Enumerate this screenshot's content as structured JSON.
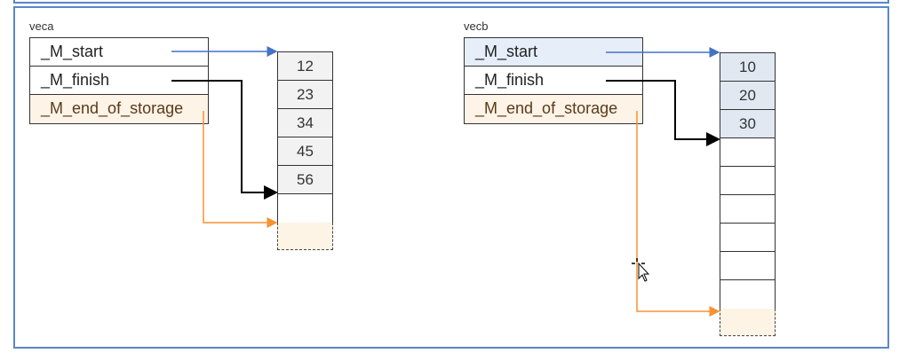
{
  "diagram": {
    "vectors": [
      {
        "name": "veca",
        "fields": [
          "_M_start",
          "_M_finish",
          "_M_end_of_storage"
        ],
        "elements": [
          "12",
          "23",
          "34",
          "45",
          "56"
        ],
        "capacity": 6
      },
      {
        "name": "vecb",
        "fields": [
          "_M_start",
          "_M_finish",
          "_M_end_of_storage"
        ],
        "elements": [
          "10",
          "20",
          "30"
        ],
        "capacity": 9
      }
    ],
    "colors": {
      "start_arrow": "#4472c4",
      "finish_arrow": "#000000",
      "end_arrow": "#f79232",
      "frame": "#5b86c8"
    }
  }
}
